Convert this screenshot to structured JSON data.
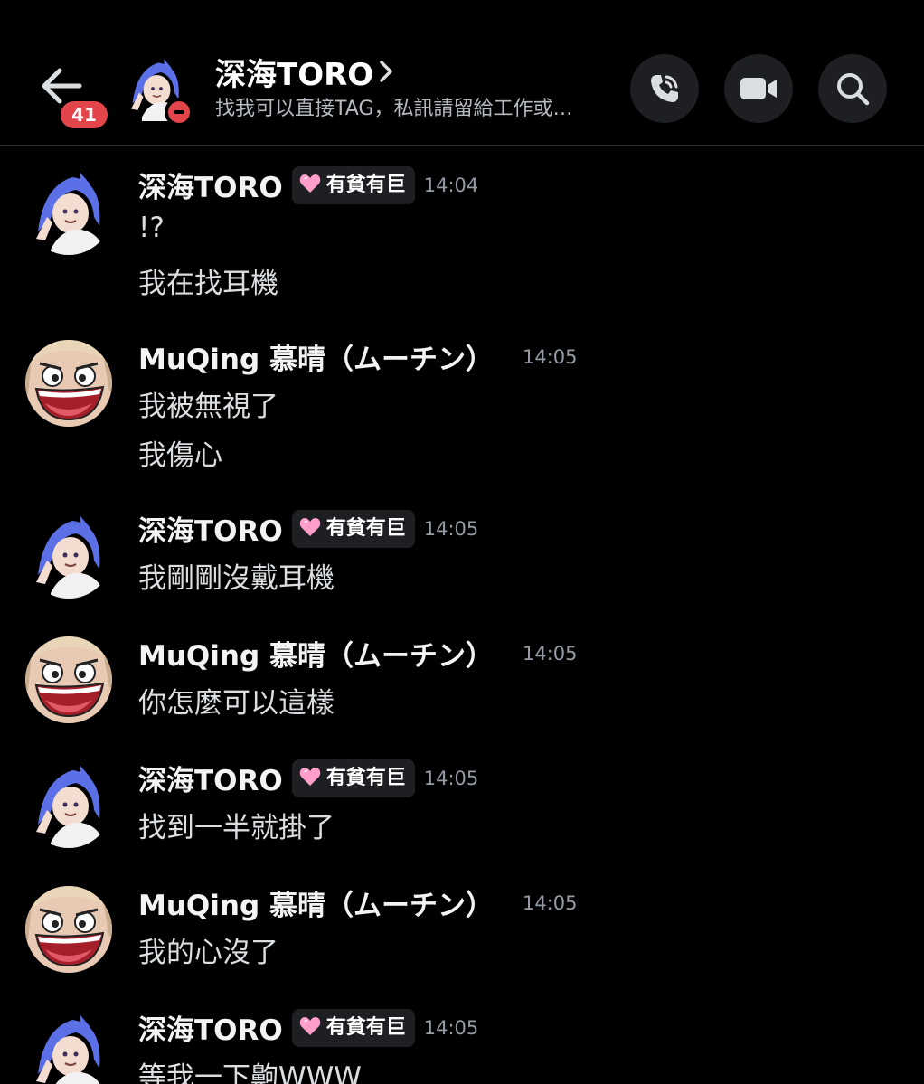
{
  "header": {
    "unread_count": "41",
    "channel_name": "深海TORO",
    "topic": "找我可以直接TAG，私訊請留給工作或…",
    "status": "dnd"
  },
  "colors": {
    "background": "#000000",
    "badge_red": "#e2454a",
    "button_bg": "#1e1f22",
    "muted_text": "#949ba4",
    "role_heart": "#ff9ecb"
  },
  "messages": [
    {
      "author": "深海TORO",
      "role_tag": "有貧有巨",
      "time": "14:04",
      "lines": [
        "!?",
        "我在找耳機"
      ]
    },
    {
      "author": "MuQing 慕晴（ムーチン）",
      "time": "14:05",
      "lines": [
        "我被無視了",
        "我傷心"
      ]
    },
    {
      "author": "深海TORO",
      "role_tag": "有貧有巨",
      "time": "14:05",
      "lines": [
        "我剛剛沒戴耳機"
      ]
    },
    {
      "author": "MuQing 慕晴（ムーチン）",
      "time": "14:05",
      "lines": [
        "你怎麼可以這樣"
      ]
    },
    {
      "author": "深海TORO",
      "role_tag": "有貧有巨",
      "time": "14:05",
      "lines": [
        "找到一半就掛了"
      ]
    },
    {
      "author": "MuQing 慕晴（ムーチン）",
      "time": "14:05",
      "lines": [
        "我的心沒了"
      ]
    },
    {
      "author": "深海TORO",
      "role_tag": "有貧有巨",
      "time": "14:05",
      "lines": [
        "等我一下齁WWW"
      ]
    }
  ]
}
